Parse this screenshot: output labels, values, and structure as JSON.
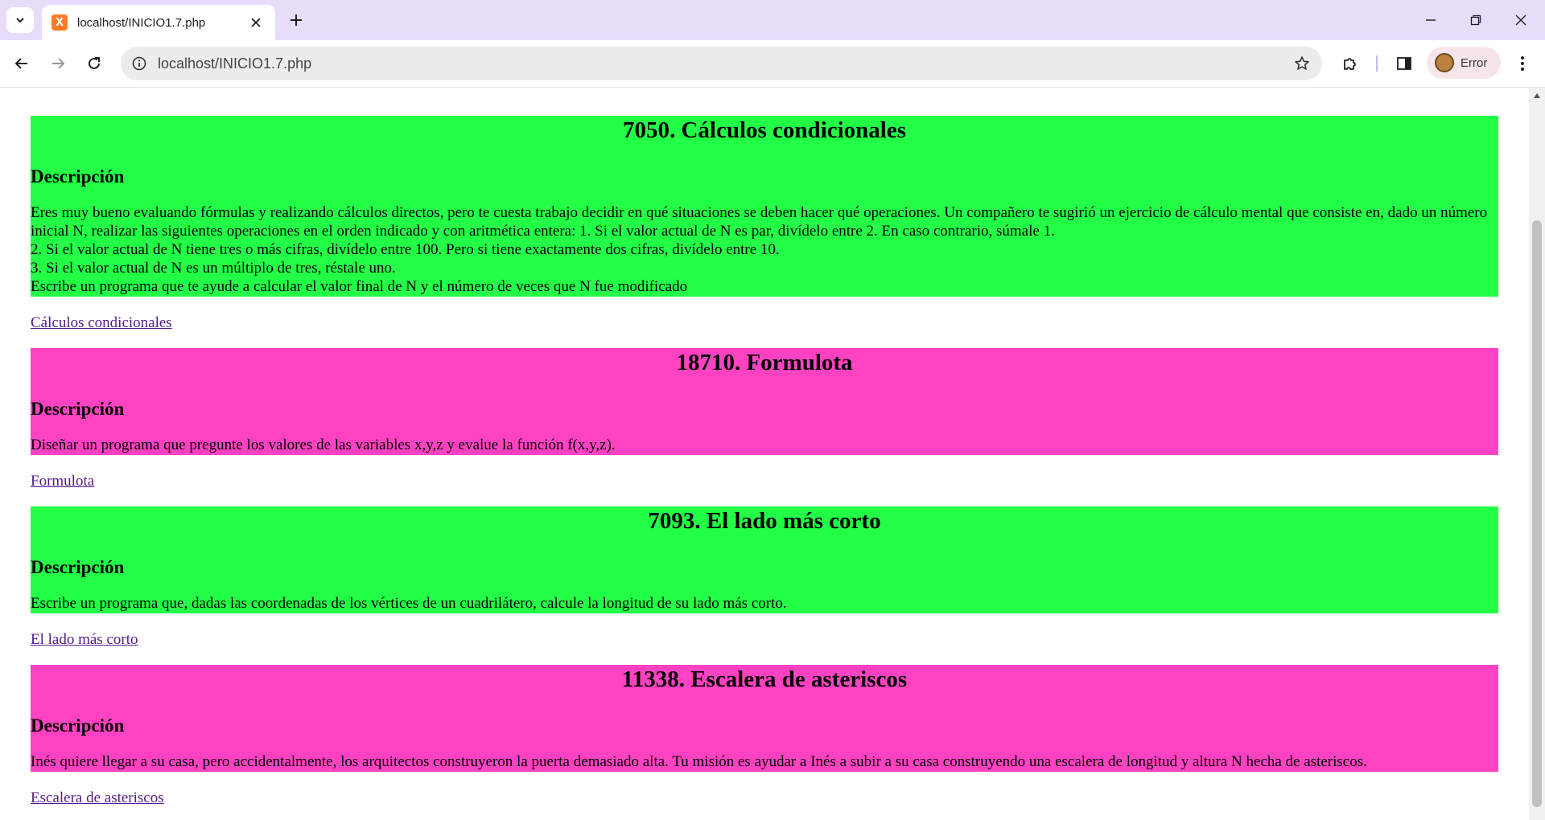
{
  "browser": {
    "tab_title": "localhost/INICIO1.7.php",
    "favicon_letter": "X",
    "url": "localhost/INICIO1.7.php",
    "profile_label": "Error",
    "colors": {
      "tabbar": "#e8dcfb",
      "toolbar": "#ffffff",
      "omnibox": "#ececec"
    }
  },
  "colors": {
    "green_card": "#23ff46",
    "pink_card": "#ff42c2",
    "link": "#551a8b"
  },
  "problems": [
    {
      "title": "7050. Cálculos condicionales",
      "heading": "Descripción",
      "description": [
        "Eres muy bueno evaluando fórmulas y realizando cálculos directos, pero te cuesta trabajo decidir en qué situaciones se deben hacer qué operaciones. Un compañero te sugirió un ejercicio de cálculo mental que consiste en, dado un número inicial N, realizar las siguientes operaciones en el orden indicado y con aritmética entera: 1. Si el valor actual de N es par, divídelo entre 2. En caso contrario, súmale 1.",
        "2. Si el valor actual de N tiene tres o más cifras, divídelo entre 100. Pero si tiene exactamente dos cifras, divídelo entre 10.",
        "3. Si el valor actual de N es un múltiplo de tres, réstale uno.",
        "Escribe un programa que te ayude a calcular el valor final de N y el número de veces que N fue modificado"
      ],
      "link": "Cálculos condicionales",
      "color": "#23ff46"
    },
    {
      "title": "18710. Formulota",
      "heading": "Descripción",
      "description": [
        "Diseñar un programa que pregunte los valores de las variables x,y,z y evalue la función f(x,y,z)."
      ],
      "link": "Formulota",
      "color": "#ff42c2"
    },
    {
      "title": "7093. El lado más corto",
      "heading": "Descripción",
      "description": [
        "Escribe un programa que, dadas las coordenadas de los vértices de un cuadrilátero, calcule la longitud de su lado más corto."
      ],
      "link": "El lado más corto",
      "color": "#23ff46"
    },
    {
      "title": "11338. Escalera de asteriscos",
      "heading": "Descripción",
      "description": [
        "Inés quiere llegar a su casa, pero accidentalmente, los arquitectos construyeron la puerta demasiado alta. Tu misión es ayudar a Inés a subir a su casa construyendo una escalera de longitud y altura N hecha de asteriscos."
      ],
      "link": "Escalera de asteriscos",
      "color": "#ff42c2"
    }
  ]
}
